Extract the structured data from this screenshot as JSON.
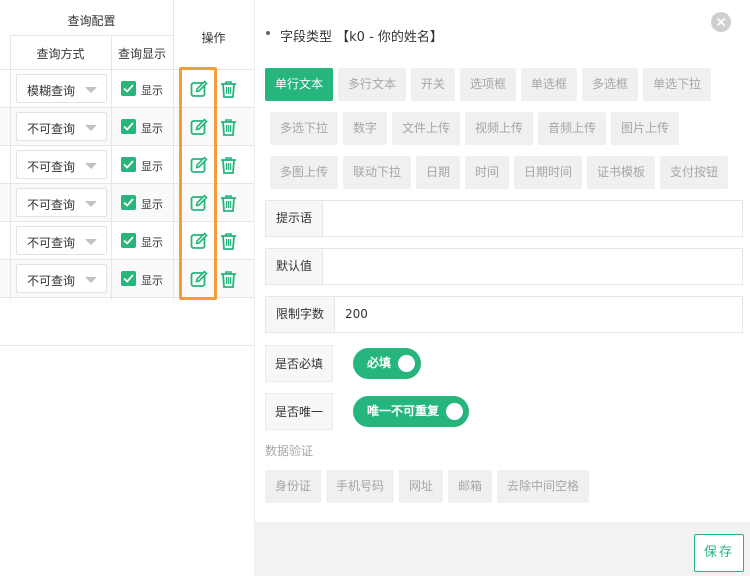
{
  "table": {
    "group_header": "查询配置",
    "col_query_mode": "查询方式",
    "col_query_display": "查询显示",
    "col_actions": "操作",
    "rows": [
      {
        "query_mode": "模糊查询",
        "display_label": "显示",
        "display_checked": true
      },
      {
        "query_mode": "不可查询",
        "display_label": "显示",
        "display_checked": true
      },
      {
        "query_mode": "不可查询",
        "display_label": "显示",
        "display_checked": true
      },
      {
        "query_mode": "不可查询",
        "display_label": "显示",
        "display_checked": true
      },
      {
        "query_mode": "不可查询",
        "display_label": "显示",
        "display_checked": true
      },
      {
        "query_mode": "不可查询",
        "display_label": "显示",
        "display_checked": true
      }
    ],
    "highlight_color": "#f39c3c"
  },
  "panel": {
    "title": "字段类型 【k0 - 你的姓名】",
    "field_types": [
      [
        "单行文本",
        "多行文本",
        "开关",
        "选项框",
        "单选框",
        "多选框",
        "单选下拉"
      ],
      [
        "多选下拉",
        "数字",
        "文件上传",
        "视频上传",
        "音频上传",
        "图片上传"
      ],
      [
        "多图上传",
        "联动下拉",
        "日期",
        "时间",
        "日期时间",
        "证书模板",
        "支付按钮"
      ]
    ],
    "active_field_type": "单行文本",
    "hint_label": "提示语",
    "hint_value": "",
    "default_label": "默认值",
    "default_value": "",
    "limit_label": "限制字数",
    "limit_value": "200",
    "required_label": "是否必填",
    "required_switch": "必填",
    "unique_label": "是否唯一",
    "unique_switch": "唯一不可重复",
    "validation_label": "数据验证",
    "validations": [
      "身份证",
      "手机号码",
      "网址",
      "邮箱",
      "去除中间空格"
    ],
    "save_label": "保存",
    "accent_color": "#26b57d"
  }
}
